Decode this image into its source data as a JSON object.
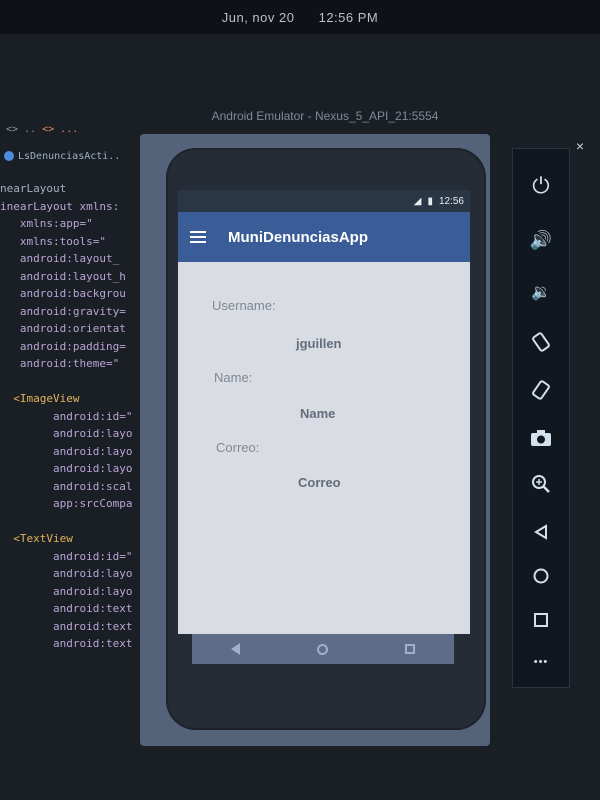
{
  "os": {
    "day": "Jun, nov 20",
    "time": "12:56 PM"
  },
  "ide": {
    "tabs": [
      "<> ..",
      "<> ..."
    ],
    "file_name": "LsDenunciasActi..",
    "code_lines": [
      "nearLayout",
      "inearLayout xmlns:",
      "   xmlns:app=\"",
      "   xmlns:tools=\"",
      "   android:layout_",
      "   android:layout_h",
      "   android:backgrou",
      "   android:gravity=",
      "   android:orientat",
      "   android:padding=",
      "   android:theme=\"",
      "",
      "  <ImageView",
      "        android:id=\"",
      "        android:layo",
      "        android:layo",
      "        android:layo",
      "        android:scal",
      "        app:srcCompa",
      "",
      "  <TextView",
      "        android:id=\"",
      "        android:layo",
      "        android:layo",
      "        android:text",
      "        android:text",
      "        android:text"
    ]
  },
  "emulator": {
    "window_title": "Android Emulator - Nexus_5_API_21:5554",
    "status_time": "12:56",
    "app_title": "MuniDenunciasApp",
    "fields": [
      {
        "label": "Username:",
        "value": "jguillen"
      },
      {
        "label": "Name:",
        "value": "Name"
      },
      {
        "label": "Correo:",
        "value": "Correo"
      }
    ],
    "toolbar": {
      "close": "×",
      "power": "⏻",
      "volume_up": "🔊",
      "volume_down": "🔉",
      "more": "•••"
    }
  }
}
